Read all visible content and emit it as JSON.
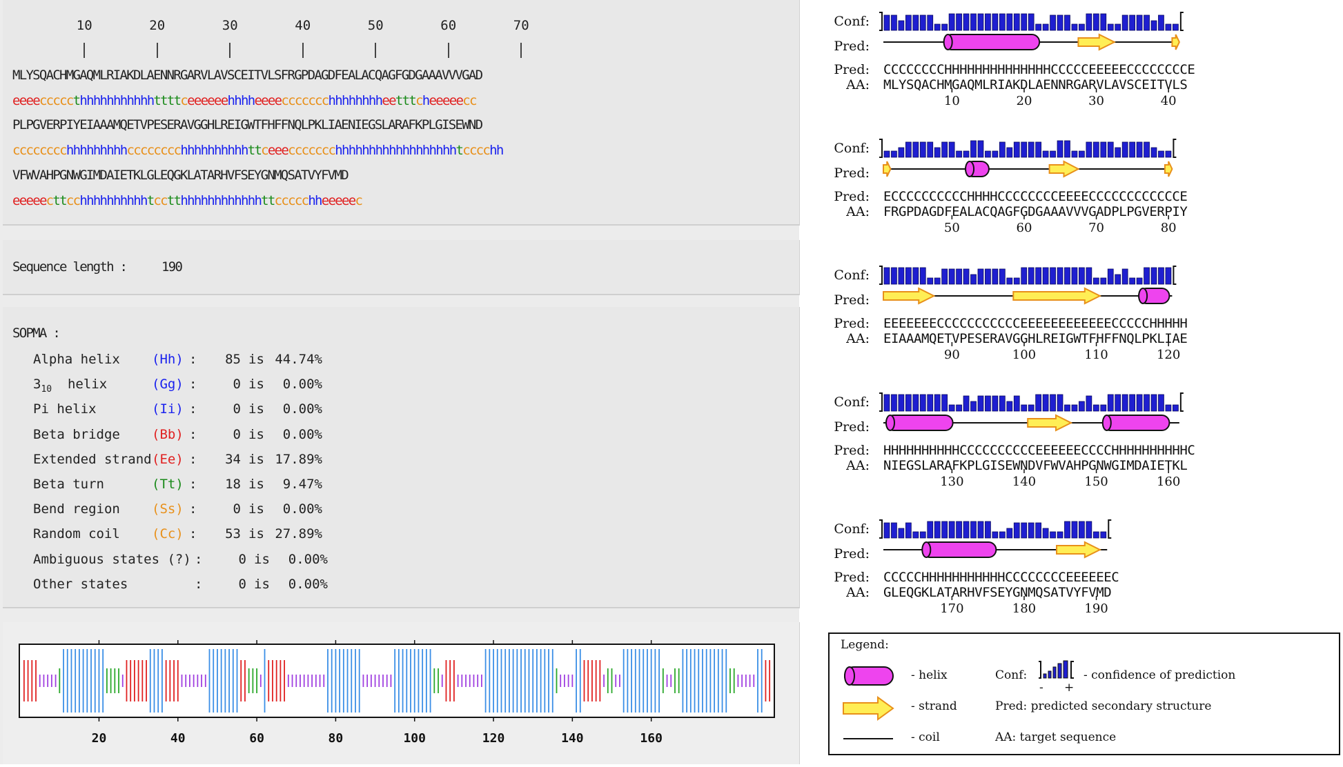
{
  "ruler": {
    "labels": [
      "10",
      "20",
      "30",
      "40",
      "50",
      "60",
      "70"
    ]
  },
  "sequence_lines": [
    {
      "seq": "MLYSQACHMGAQMLRIAKDLAENNRGARVLAVSCEITVLSFRGPDAGDFEALACQAGFGDGAAAVVVGAD",
      "ss": "eeeecccccthhhhhhhhhhhttttceeeeeehhhheeeeccccccchhhhhhhheetttcheeeeecc"
    },
    {
      "seq": "PLPGVERPIYEIAAAMQETVPESERAVGGHLREIGWTFHFFNQLPKLIAENIEGSLARAFKPLGISEWND",
      "ss": "cccccccchhhhhhhhhcccccccchhhhhhhhhhttceeeccccccchhhhhhhhhhhhhhhhhhtcccchh"
    },
    {
      "seq": "VFWVAHPGNWGIMDAIETKLGLEQGKLATARHVFSEYGNMQSATVYFVMD",
      "ss": "eeeeecttcchhhhhhhhhhtcctthhhhhhhhhhhhttccccchheeeeec"
    }
  ],
  "ss_colors": {
    "h": "#1a22ee",
    "e": "#e02020",
    "t": "#1a8a1a",
    "c": "#e8901a",
    "s": "#e8901a"
  },
  "sequence_length": {
    "label": "Sequence length :",
    "value": "190"
  },
  "sopma": {
    "title": "SOPMA :",
    "rows": [
      {
        "name": "Alpha helix",
        "code": "(Hh)",
        "count": "85",
        "pct": "44.74%",
        "color": "#1a22ee"
      },
      {
        "name": "310 helix",
        "code": "(Gg)",
        "count": "0",
        "pct": "0.00%",
        "color": "#1a22ee"
      },
      {
        "name": "Pi helix",
        "code": "(Ii)",
        "count": "0",
        "pct": "0.00%",
        "color": "#1a22ee"
      },
      {
        "name": "Beta bridge",
        "code": "(Bb)",
        "count": "0",
        "pct": "0.00%",
        "color": "#e02020"
      },
      {
        "name": "Extended strand",
        "code": "(Ee)",
        "count": "34",
        "pct": "17.89%",
        "color": "#e02020"
      },
      {
        "name": "Beta turn",
        "code": "(Tt)",
        "count": "18",
        "pct": "9.47%",
        "color": "#1a8a1a"
      },
      {
        "name": "Bend region",
        "code": "(Ss)",
        "count": "0",
        "pct": "0.00%",
        "color": "#e8901a"
      },
      {
        "name": "Random coil",
        "code": "(Cc)",
        "count": "53",
        "pct": "27.89%",
        "color": "#e8901a"
      },
      {
        "name": "Ambiguous states (?)",
        "code": "",
        "count": "0",
        "pct": "0.00%",
        "color": "#222"
      },
      {
        "name": "Other states",
        "code": "",
        "count": "0",
        "pct": "0.00%",
        "color": "#222"
      }
    ],
    "is_word": "is"
  },
  "profile": {
    "axis_labels": [
      "20",
      "40",
      "60",
      "80",
      "100",
      "120",
      "140",
      "160"
    ]
  },
  "psipred_blocks": [
    {
      "pred": "CCCCCCCCHHHHHHHHHHHHHHCCCCCEEEEECCCCCCCCE",
      "aa": "MLYSQACHMGAQMLRIAKDLAENNRGARVLAVSCEITVLS",
      "ticks": [
        "10",
        "20",
        "30",
        "40"
      ]
    },
    {
      "pred": "ECCCCCCCCCCHHHHCCCCCCCCEEEECCCCCCCCCCCCE",
      "aa": "FRGPDAGDFEALACQAGFGDGAAAVVVGADPLPGVERPIY",
      "ticks": [
        "50",
        "60",
        "70",
        "80"
      ]
    },
    {
      "pred": "EEEEEEECCCCCCCCCCCEEEEEEEEEEEECCCCCHHHHH",
      "aa": "EIAAAMQETVPESERAVGGHLREIGWTFHFFNQLPKLIAE",
      "ticks": [
        "90",
        "100",
        "110",
        "120"
      ]
    },
    {
      "pred": "HHHHHHHHHHCCCCCCCCCCEEEEEECCCCHHHHHHHHHHC",
      "aa": "NIEGSLARAFKPLGISEWNDVFWVAHPGNWGIMDAIETKL",
      "ticks": [
        "130",
        "140",
        "150",
        "160"
      ]
    },
    {
      "pred": "CCCCCHHHHHHHHHHHCCCCCCCCEEEEEEC",
      "aa": "GLEQGKLATARHVFSEYGNMQSATVYFVMD",
      "ticks": [
        "170",
        "180",
        "190"
      ]
    }
  ],
  "row_labels": {
    "conf": "Conf:",
    "pred": "Pred:",
    "aa": "AA:"
  },
  "legend": {
    "title": "Legend:",
    "helix": "- helix",
    "strand": "- strand",
    "coil": "- coil",
    "conf_label": "Conf:",
    "conf_desc": "- confidence of prediction",
    "conf_minus": "-",
    "conf_plus": "+",
    "pred_desc": "Pred: predicted secondary structure",
    "aa_desc": "AA: target sequence"
  }
}
